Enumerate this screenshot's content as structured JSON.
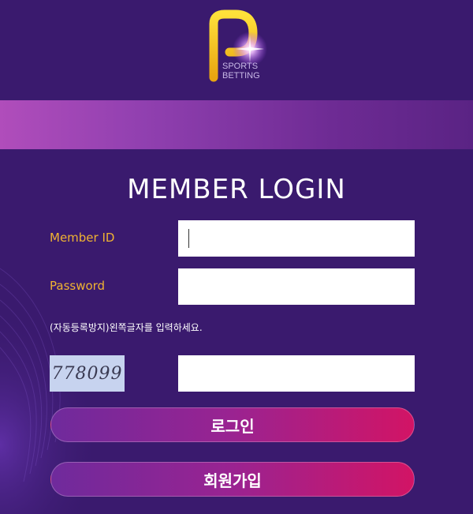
{
  "logo": {
    "line1": "SPORTS",
    "line2": "BETTING"
  },
  "login": {
    "title": "MEMBER LOGIN",
    "member_id_label": "Member ID",
    "member_id_value": "",
    "password_label": "Password",
    "password_value": "",
    "captcha_notice": "(자동등록방지)왼쪽글자를 입력하세요.",
    "captcha_code": "778099",
    "captcha_value": "",
    "login_button": "로그인",
    "signup_button": "회원가입"
  },
  "colors": {
    "background": "#3a1a6e",
    "label": "#f0b332",
    "button_start": "#6f2a9c",
    "button_end": "#d21465"
  }
}
